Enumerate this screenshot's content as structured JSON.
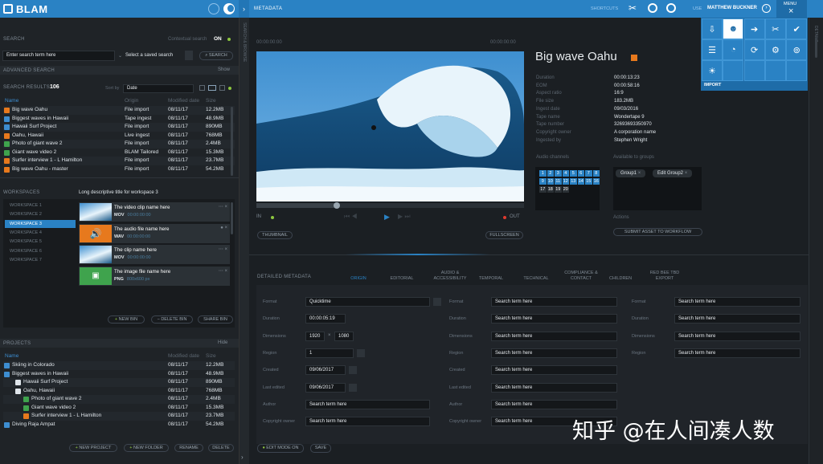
{
  "app": {
    "logo": "BLAM",
    "section": "METADATA"
  },
  "topbar": {
    "shortcuts": "SHORTCUTS",
    "user_label": "USE",
    "user": "MATTHEW BUCKNER",
    "menu": "MENU"
  },
  "menu": {
    "import": "IMPORT"
  },
  "search": {
    "title": "SEARCH",
    "contextual": "Contextual search",
    "contextual_value": "ON",
    "placeholder": "Enter search term here",
    "saved": "Select a saved search",
    "button": "SEARCH",
    "advanced": "ADVANCED SEARCH",
    "show": "Show"
  },
  "results": {
    "label": "SEARCH RESULTS",
    "count": "106",
    "sortby": "Sort by",
    "sort": "Date",
    "columns": [
      "Name",
      "Origin",
      "Modified date",
      "Size"
    ],
    "rows": [
      [
        "Big wave Oahu",
        "File import",
        "08/11/17",
        "12.2MB"
      ],
      [
        "Biggest waves in Hawaii",
        "Tape ingest",
        "08/11/17",
        "48.9MB"
      ],
      [
        "Hawaii Surf Project",
        "File import",
        "08/11/17",
        "890MB"
      ],
      [
        "Oahu, Hawaii",
        "Live ingest",
        "08/11/17",
        "768MB"
      ],
      [
        "Photo of giant wave 2",
        "File import",
        "08/11/17",
        "2.4MB"
      ],
      [
        "Giant wave video 2",
        "BLAM Tailored",
        "08/11/17",
        "15.3MB"
      ],
      [
        "Surfer interview 1 - L Hamilton",
        "File import",
        "08/11/17",
        "23.7MB"
      ],
      [
        "Big wave Oahu - master",
        "File import",
        "08/11/17",
        "54.2MB"
      ]
    ]
  },
  "workspaces": {
    "title": "WORKSPACES",
    "desc": "Long descriptive title for workspace 3",
    "items": [
      "WORKSPACE 1",
      "WORKSPACE 2",
      "WORKSPACE 3",
      "WORKSPACE 4",
      "WORKSPACE 5",
      "WORKSPACE 6",
      "WORKSPACE 7"
    ],
    "cards": [
      {
        "title": "The video clip name here",
        "fmt": "MOV",
        "tc": "00:00:00:00"
      },
      {
        "title": "The audio file name here",
        "fmt": "WAV",
        "tc": "00:00:00:00"
      },
      {
        "title": "The clip name here",
        "fmt": "MOV",
        "tc": "00:00:00:00"
      },
      {
        "title": "The image file name here",
        "fmt": "PNG",
        "tc": "800x600 px"
      }
    ],
    "new_bin": "NEW BIN",
    "delete_bin": "DELETE BIN",
    "share_bin": "SHARE BIN"
  },
  "projects": {
    "title": "PROJECTS",
    "hide": "Hide",
    "columns": [
      "Name",
      "Modified date",
      "Size"
    ],
    "rows": [
      [
        "Skiing in Colorado",
        "08/11/17",
        "12.2MB"
      ],
      [
        "Biggest waves in Hawaii",
        "08/11/17",
        "48.9MB"
      ],
      [
        "Hawaii Surf Project",
        "08/11/17",
        "890MB"
      ],
      [
        "Oahu, Hawaii",
        "08/11/17",
        "768MB"
      ],
      [
        "Photo of giant wave 2",
        "08/11/17",
        "2.4MB"
      ],
      [
        "Giant wave video 2",
        "08/11/17",
        "15.3MB"
      ],
      [
        "Surfer interview 1 - L Hamilton",
        "08/11/17",
        "23.7MB"
      ],
      [
        "Diving Raja Ampat",
        "08/11/17",
        "54.2MB"
      ]
    ],
    "new_project": "NEW PROJECT",
    "new_folder": "NEW FOLDER",
    "rename": "RENAME",
    "delete": "DELETE"
  },
  "side_tabs": {
    "search": "SEARCH & BROWSE",
    "details": "DETAILS"
  },
  "player": {
    "tc_start": "00:00:00:00",
    "tc_end": "00:00:00:00",
    "in": "IN",
    "out": "OUT",
    "thumbnail": "THUMBNAIL",
    "fullscreen": "FULLSCREEN",
    "progress": 0.3
  },
  "asset": {
    "title": "Big wave Oahu",
    "fields": [
      [
        "Duration",
        "00:00:13:23"
      ],
      [
        "EOM",
        "00:00:58:16"
      ],
      [
        "Aspect ratio",
        "16:9"
      ],
      [
        "File size",
        "183.2MB"
      ],
      [
        "Ingest date",
        "09/03/2016"
      ],
      [
        "Tape name",
        "Wondertape 9"
      ],
      [
        "Tape number",
        "32693693350970"
      ],
      [
        "Copyright owner",
        "A corporation name"
      ],
      [
        "Ingested by",
        "Stephen Wright"
      ]
    ],
    "audio_label": "Audio channels",
    "groups_label": "Available to groups",
    "channels": [
      "1",
      "2",
      "3",
      "4",
      "5",
      "6",
      "7",
      "8",
      "9",
      "10",
      "11",
      "12",
      "13",
      "14",
      "15",
      "16",
      "17",
      "18",
      "19",
      "20"
    ],
    "groups": [
      "Group1",
      "Edit Group2"
    ],
    "actions": "Actions",
    "submit": "SUBMIT ASSET TO WORKFLOW"
  },
  "detailed": {
    "title": "DETAILED METADATA",
    "tabs": [
      "ORIGIN",
      "EDITORIAL",
      "AUDIO & ACCESSIBILITY",
      "TEMPORAL",
      "TECHNICAL",
      "COMPLIANCE & CONTACT",
      "CHILDREN",
      "RED BEE TBD EXPORT"
    ],
    "col1": [
      [
        "Format",
        "Quicktime"
      ],
      [
        "Duration",
        "00:00:05:19"
      ],
      [
        "Dimensions",
        "1920",
        "1080"
      ],
      [
        "Region",
        "1"
      ],
      [
        "Created",
        "09/06/2017"
      ],
      [
        "Last edited",
        "09/06/2017"
      ],
      [
        "Author",
        "Search term here"
      ],
      [
        "Copyright owner",
        "Search term here"
      ]
    ],
    "col2": [
      "Format",
      "Duration",
      "Dimensions",
      "Region",
      "Created",
      "Last edited",
      "Author",
      "Copyright owner"
    ],
    "col3": [
      "Format",
      "Duration",
      "Dimensions",
      "Region"
    ],
    "placeholder": "Search term here",
    "edit_mode": "EDIT MODE ON",
    "save": "SAVE"
  },
  "watermark": "知乎 @在人间凑人数"
}
